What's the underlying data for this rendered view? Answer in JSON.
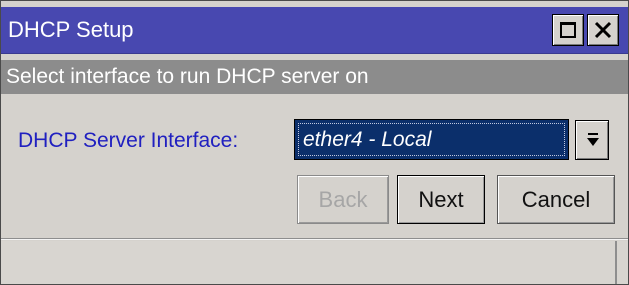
{
  "window": {
    "title": "DHCP Setup",
    "subtitle": "Select interface to run DHCP server on"
  },
  "titlebar_buttons": {
    "maximize_icon": "maximize-icon",
    "close_icon": "close-icon"
  },
  "form": {
    "field_label": "DHCP Server Interface:",
    "selected_value": "ether4 - Local",
    "dropdown_icon": "dropdown-arrow-icon"
  },
  "buttons": {
    "back_label": "Back",
    "back_enabled": false,
    "next_label": "Next",
    "cancel_label": "Cancel"
  },
  "colors": {
    "titlebar": "#4848b0",
    "subtitle_bar": "#8c8c8c",
    "label_text": "#2020c0",
    "select_bg": "#0b2f6b",
    "window_bg": "#d5d2cd"
  }
}
